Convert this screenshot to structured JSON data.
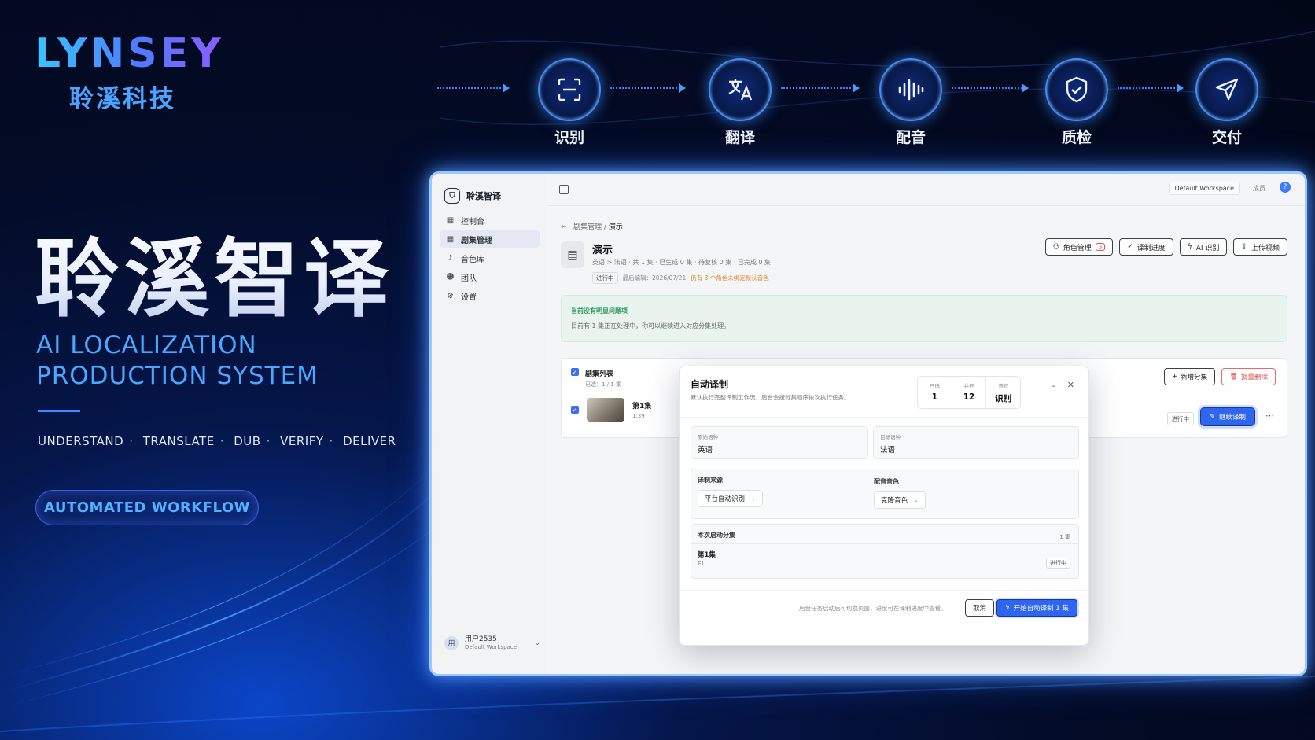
{
  "brand": {
    "logo_en": "LYNSEY",
    "logo_cn": "聆溪科技",
    "hero_cn": "聆溪智译",
    "hero_en_line1": "AI LOCALIZATION",
    "hero_en_line2": "PRODUCTION SYSTEM",
    "steps": [
      "UNDERSTAND",
      "TRANSLATE",
      "DUB",
      "VERIFY",
      "DELIVER"
    ],
    "workflow_button": "AUTOMATED WORKFLOW",
    "accent": "#3e8dff"
  },
  "pipeline": [
    {
      "label": "识别",
      "icon": "scan-icon"
    },
    {
      "label": "翻译",
      "icon": "translate-icon"
    },
    {
      "label": "配音",
      "icon": "audio-wave-icon"
    },
    {
      "label": "质检",
      "icon": "shield-check-icon"
    },
    {
      "label": "交付",
      "icon": "send-icon"
    }
  ],
  "app": {
    "name": "聆溪智译",
    "workspace_badge": "Default Workspace",
    "member_label": "成员",
    "sidebar": {
      "items": [
        {
          "label": "控制台",
          "icon": "dashboard-icon"
        },
        {
          "label": "剧集管理",
          "icon": "grid-icon"
        },
        {
          "label": "音色库",
          "icon": "mic-icon"
        },
        {
          "label": "团队",
          "icon": "team-icon"
        },
        {
          "label": "设置",
          "icon": "settings-icon"
        }
      ],
      "user_name": "用户2535",
      "user_workspace": "Default Workspace",
      "user_avatar": "用"
    },
    "breadcrumb": {
      "parent": "剧集管理",
      "current": "演示"
    },
    "project": {
      "title": "演示",
      "meta": "英语 > 法语 · 共 1 集 · 已生成 0 集 · 待复核 0 集 · 已完成 0 集",
      "status_tag": "进行中",
      "last_edit": "最后编辑：2026/07/21",
      "warning": "仍有 3 个角色未绑定默认音色"
    },
    "header_buttons": [
      {
        "label": "角色管理",
        "count": "3"
      },
      {
        "label": "译制进度"
      },
      {
        "label": "AI 识别"
      },
      {
        "label": "上传视频"
      }
    ],
    "notice": {
      "title": "当前没有明显问题项",
      "body": "目前有 1 集正在处理中，你可以继续进入对应分集处理。"
    },
    "episode_list": {
      "title": "剧集列表",
      "subtitle": "已选：1 / 1 集",
      "add_button": "新增分集",
      "delete_button": "批量删除",
      "rows": [
        {
          "name": "第1集",
          "duration": "1:39",
          "status": "进行中",
          "action": "继续译制"
        }
      ]
    },
    "modal": {
      "title": "自动译制",
      "description": "默认执行完整译制工作流，后台会按分集顺序依次执行任务。",
      "stats": [
        {
          "label": "已选",
          "value": "1"
        },
        {
          "label": "并行",
          "value": "12"
        },
        {
          "label": "流程",
          "value": "识别"
        }
      ],
      "source_lang_label": "原始语种",
      "source_lang": "英语",
      "target_lang_label": "目标语种",
      "target_lang": "法语",
      "source_label": "译制来源",
      "source_value": "平台自动识别",
      "voice_label": "配音音色",
      "voice_value": "克隆音色",
      "episodes_title": "本次启动分集",
      "episodes_count": "1 集",
      "episode_name": "第1集",
      "episode_code": "E1",
      "episode_status": "进行中",
      "footer_hint": "后台任务启动后可切换页面，进度可在译制进度中查看。",
      "cancel": "取消",
      "start": "开始自动译制 1 集"
    }
  }
}
